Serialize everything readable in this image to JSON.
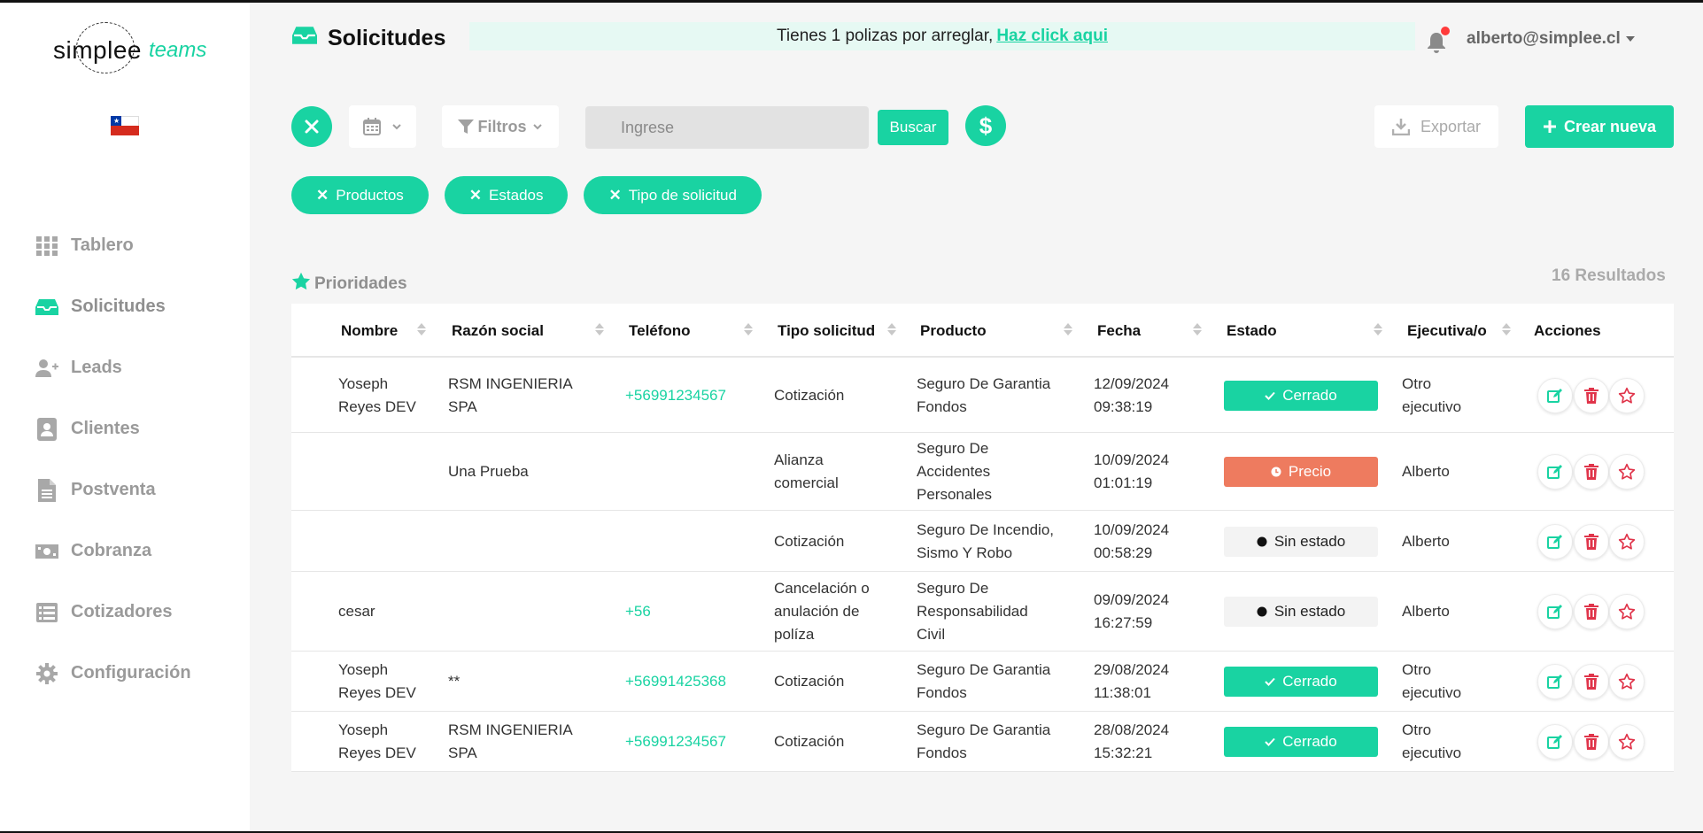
{
  "app": {
    "brand": "simplee",
    "brand_suffix": "teams"
  },
  "sidebar": {
    "items": [
      {
        "label": "Tablero",
        "icon": "grid-icon"
      },
      {
        "label": "Solicitudes",
        "icon": "inbox-icon",
        "active": true
      },
      {
        "label": "Leads",
        "icon": "user-plus-icon"
      },
      {
        "label": "Clientes",
        "icon": "id-card-icon"
      },
      {
        "label": "Postventa",
        "icon": "document-icon"
      },
      {
        "label": "Cobranza",
        "icon": "money-icon"
      },
      {
        "label": "Cotizadores",
        "icon": "list-icon"
      },
      {
        "label": "Configuración",
        "icon": "gear-icon"
      }
    ]
  },
  "header": {
    "title": "Solicitudes",
    "banner_text": "Tienes 1 polizas por arreglar,",
    "banner_link": " Haz click aqui",
    "user": "alberto@simplee.cl"
  },
  "toolbar": {
    "filters_label": "Filtros",
    "search_placeholder": "Ingrese",
    "search_button": "Buscar",
    "export_label": "Exportar",
    "new_label": "Crear nueva"
  },
  "chips": [
    "Productos",
    "Estados",
    "Tipo de solicitud"
  ],
  "priorities_label": "Prioridades",
  "results_label": "16 Resultados",
  "table": {
    "columns": [
      "Nombre",
      "Razón social",
      "Teléfono",
      "Tipo solicitud",
      "Producto",
      "Fecha",
      "Estado",
      "Ejecutiva/o",
      "Acciones"
    ],
    "rows": [
      {
        "nombre": [
          "Yoseph",
          "Reyes DEV"
        ],
        "razon": [
          "RSM INGENIERIA",
          "SPA"
        ],
        "telefono": "+56991234567",
        "tipo": [
          "Cotización"
        ],
        "producto": [
          "Seguro De Garantia",
          "Fondos"
        ],
        "fecha": [
          "12/09/2024",
          "09:38:19"
        ],
        "estado": "Cerrado",
        "estado_type": "cerrado",
        "ejecutivo": [
          "Otro",
          "ejecutivo"
        ]
      },
      {
        "nombre": [],
        "razon": [
          "Una Prueba"
        ],
        "telefono": "",
        "tipo": [
          "Alianza",
          "comercial"
        ],
        "producto": [
          "Seguro De",
          "Accidentes",
          "Personales"
        ],
        "fecha": [
          "10/09/2024",
          "01:01:19"
        ],
        "estado": "Precio",
        "estado_type": "precio",
        "ejecutivo": [
          "Alberto"
        ]
      },
      {
        "nombre": [],
        "razon": [],
        "telefono": "",
        "tipo": [
          "Cotización"
        ],
        "producto": [
          "Seguro De Incendio,",
          "Sismo Y Robo"
        ],
        "fecha": [
          "10/09/2024",
          "00:58:29"
        ],
        "estado": "Sin estado",
        "estado_type": "sin",
        "ejecutivo": [
          "Alberto"
        ]
      },
      {
        "nombre": [
          "cesar"
        ],
        "razon": [],
        "telefono": "+56",
        "tipo": [
          "Cancelación o",
          "anulación de",
          "políza"
        ],
        "producto": [
          "Seguro De",
          "Responsabilidad",
          "Civil"
        ],
        "fecha": [
          "09/09/2024",
          "16:27:59"
        ],
        "estado": "Sin estado",
        "estado_type": "sin",
        "ejecutivo": [
          "Alberto"
        ]
      },
      {
        "nombre": [
          "Yoseph",
          "Reyes DEV"
        ],
        "razon": [
          "**"
        ],
        "telefono": "+56991425368",
        "tipo": [
          "Cotización"
        ],
        "producto": [
          "Seguro De Garantia",
          "Fondos"
        ],
        "fecha": [
          "29/08/2024",
          "11:38:01"
        ],
        "estado": "Cerrado",
        "estado_type": "cerrado",
        "ejecutivo": [
          "Otro",
          "ejecutivo"
        ]
      },
      {
        "nombre": [
          "Yoseph",
          "Reyes DEV"
        ],
        "razon": [
          "RSM INGENIERIA",
          "SPA"
        ],
        "telefono": "+56991234567",
        "tipo": [
          "Cotización"
        ],
        "producto": [
          "Seguro De Garantia",
          "Fondos"
        ],
        "fecha": [
          "28/08/2024",
          "15:32:21"
        ],
        "estado": "Cerrado",
        "estado_type": "cerrado",
        "ejecutivo": [
          "Otro",
          "ejecutivo"
        ]
      }
    ]
  },
  "colors": {
    "accent": "#19d3a2",
    "precio": "#ee7b5f",
    "danger": "#e0344a"
  }
}
